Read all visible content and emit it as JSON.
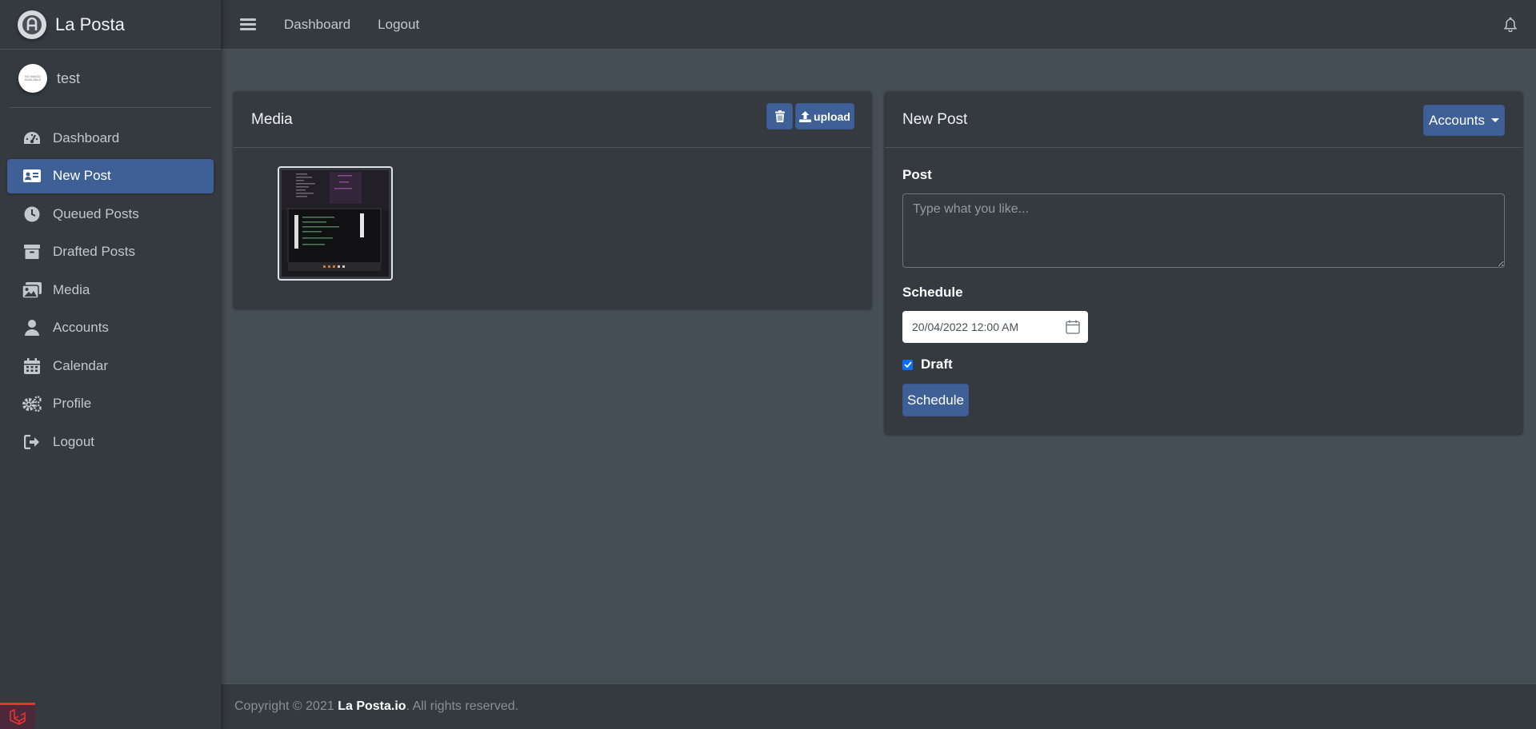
{
  "brand": {
    "name": "La Posta"
  },
  "user": {
    "name": "test",
    "avatar_text": "NO IMAGE AVAILABLE"
  },
  "sidebar": {
    "items": [
      {
        "label": "Dashboard",
        "icon": "tachometer-icon"
      },
      {
        "label": "New Post",
        "icon": "id-card-icon",
        "active": true
      },
      {
        "label": "Queued Posts",
        "icon": "clock-icon"
      },
      {
        "label": "Drafted Posts",
        "icon": "archive-icon"
      },
      {
        "label": "Media",
        "icon": "images-icon"
      },
      {
        "label": "Accounts",
        "icon": "user-icon"
      },
      {
        "label": "Calendar",
        "icon": "calendar-icon"
      },
      {
        "label": "Profile",
        "icon": "cogs-icon"
      },
      {
        "label": "Logout",
        "icon": "sign-out-icon"
      }
    ]
  },
  "topbar": {
    "links": [
      "Dashboard",
      "Logout"
    ]
  },
  "media": {
    "title": "Media",
    "upload_label": "upload"
  },
  "new_post": {
    "title": "New Post",
    "accounts_label": "Accounts",
    "post_label": "Post",
    "post_placeholder": "Type what you like...",
    "schedule_label": "Schedule",
    "schedule_value": "20/04/2022 12:00 AM",
    "draft_label": "Draft",
    "draft_checked": true,
    "schedule_button": "Schedule"
  },
  "footer": {
    "prefix": "Copyright © 2021",
    "brand": "La Posta.io",
    "suffix": ". All rights reserved."
  },
  "colors": {
    "primary": "#3f6097",
    "sidebar_bg": "#343a40",
    "content_bg": "#454d55",
    "checkbox": "#0d6efd"
  }
}
